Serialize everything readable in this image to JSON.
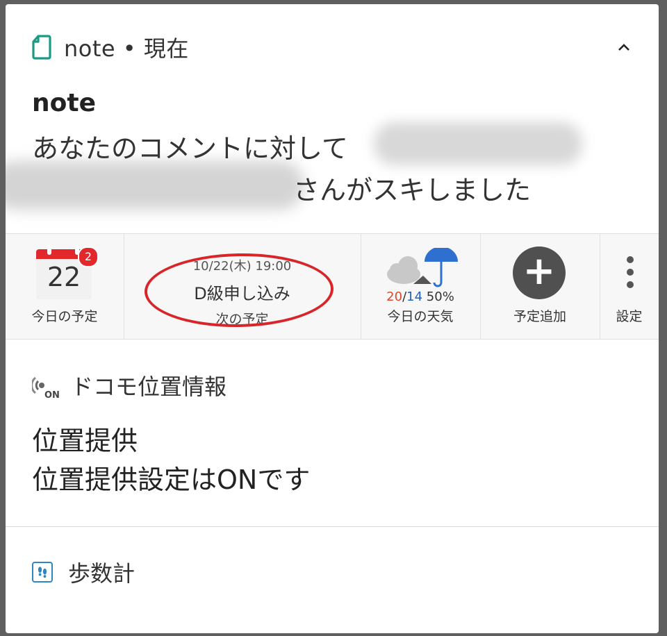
{
  "note": {
    "app_name": "note",
    "separator": "•",
    "time": "現在",
    "title": "note",
    "body_line1": "あなたのコメントに対して",
    "body_line2": "さんがスキしました",
    "collapse_icon": "chevron-up-icon"
  },
  "widget_bar": {
    "calendar": {
      "day": "22",
      "badge_count": "2",
      "label": "今日の予定",
      "icon": "calendar-icon"
    },
    "next_event": {
      "when": "10/22(木) 19:00",
      "title": "D級申し込み",
      "label": "次の予定"
    },
    "weather": {
      "high": "20",
      "slash": "/",
      "low": "14",
      "rain": "50%",
      "label": "今日の天気",
      "icon": "cloud-umbrella-icon"
    },
    "add_event": {
      "label": "予定追加",
      "icon": "plus-icon"
    },
    "settings": {
      "label": "設定",
      "icon": "more-vertical-icon"
    },
    "colors": {
      "calendar_red": "#e1282b",
      "annotation_red": "#d8252a",
      "temp_high": "#e0462e",
      "temp_low": "#1f5fbf"
    }
  },
  "location": {
    "app_name": "ドコモ位置情報",
    "icon": "location-signal-on-icon",
    "title": "位置提供",
    "text": "位置提供設定はONです"
  },
  "pedometer": {
    "app_name": "歩数計",
    "icon": "footprints-icon"
  }
}
